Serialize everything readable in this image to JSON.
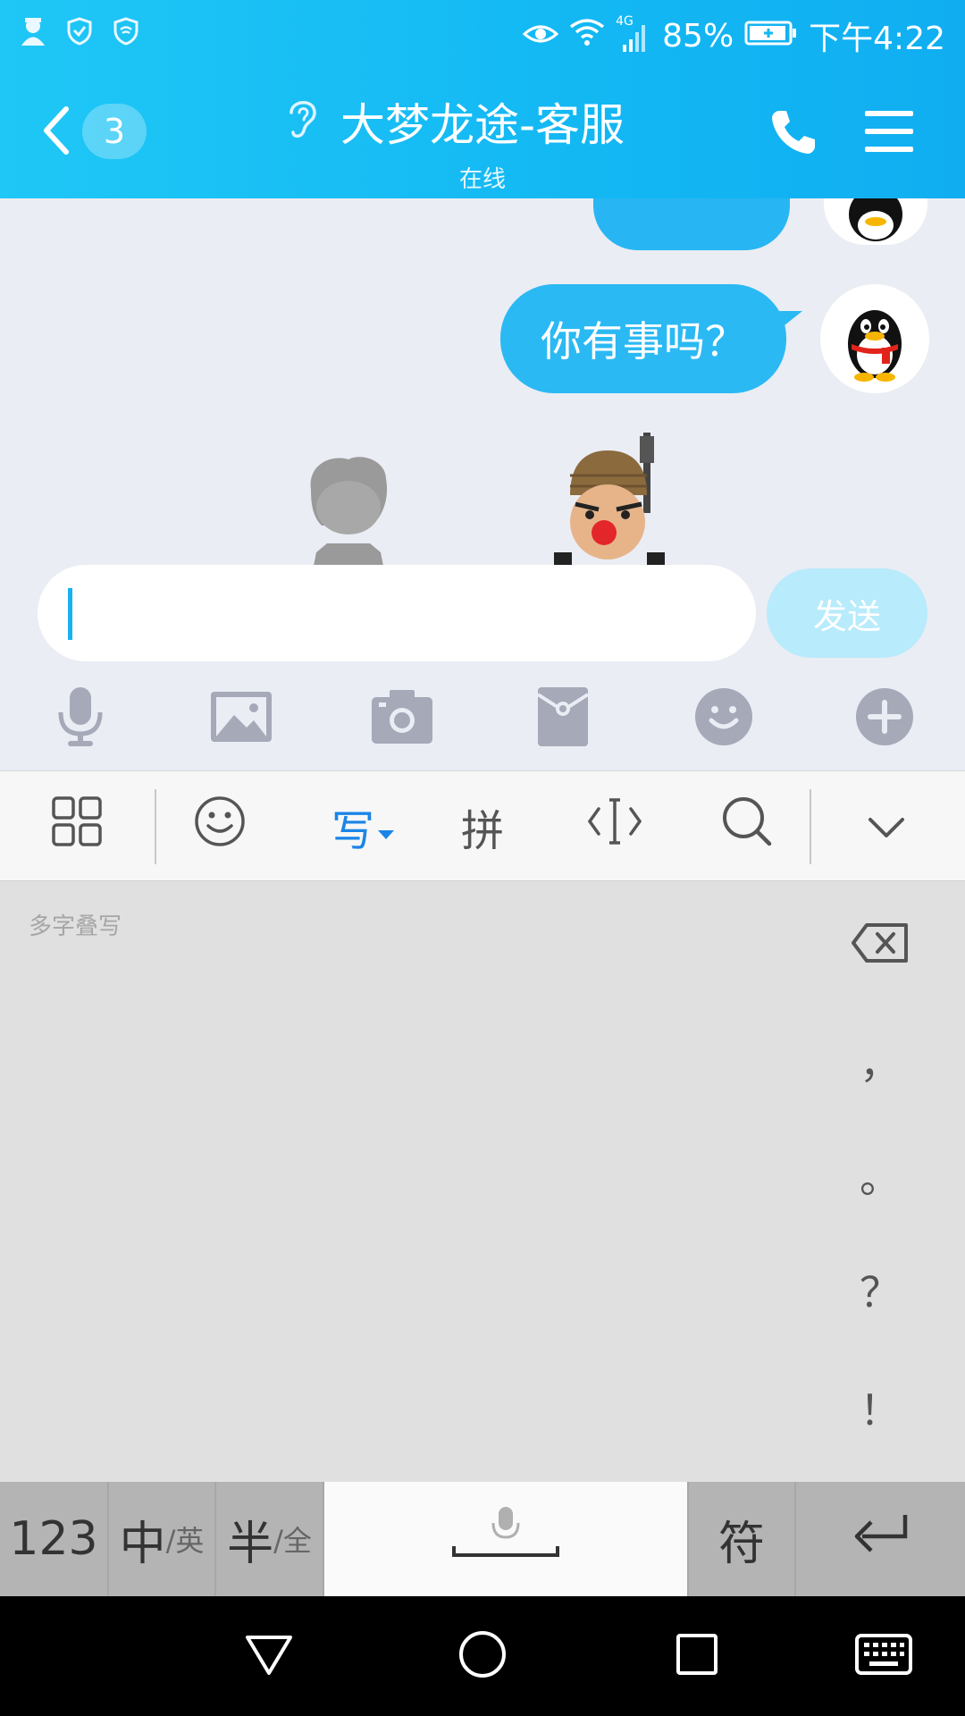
{
  "status_bar": {
    "network_type": "4G",
    "battery_percent": "85%",
    "time": "下午4:22",
    "icons": [
      "avatar-icon",
      "shield-check-icon",
      "shield-wifi-icon",
      "eye-icon",
      "wifi-icon",
      "signal-icon",
      "battery-charging-icon"
    ]
  },
  "header": {
    "unread_count": "3",
    "title": "大梦龙途-客服",
    "subtitle": "在线",
    "icons": [
      "back-icon",
      "ear-icon",
      "phone-icon",
      "menu-icon"
    ]
  },
  "chat": {
    "messages": [
      {
        "from": "me",
        "text": "你有事吗？"
      }
    ]
  },
  "input": {
    "value": "",
    "send_label": "发送"
  },
  "toolbar": {
    "icons": [
      "mic-icon",
      "image-icon",
      "camera-icon",
      "red-packet-icon",
      "emoji-icon",
      "plus-icon"
    ]
  },
  "keyboard": {
    "top_row": {
      "handwrite_label": "写",
      "pinyin_label": "拼"
    },
    "hint": "多字叠写",
    "punctuation": [
      "，",
      "。",
      "？",
      "！"
    ],
    "bottom_row": {
      "num_label": "123",
      "lang_main": "中",
      "lang_sub": "/英",
      "width_main": "半",
      "width_sub": "/全",
      "symbol_label": "符"
    }
  },
  "colors": {
    "header": "#13b8f3",
    "bubble": "#2bb9f4",
    "send_disabled": "#b8ebfb",
    "accent_blue": "#1a85e8"
  }
}
